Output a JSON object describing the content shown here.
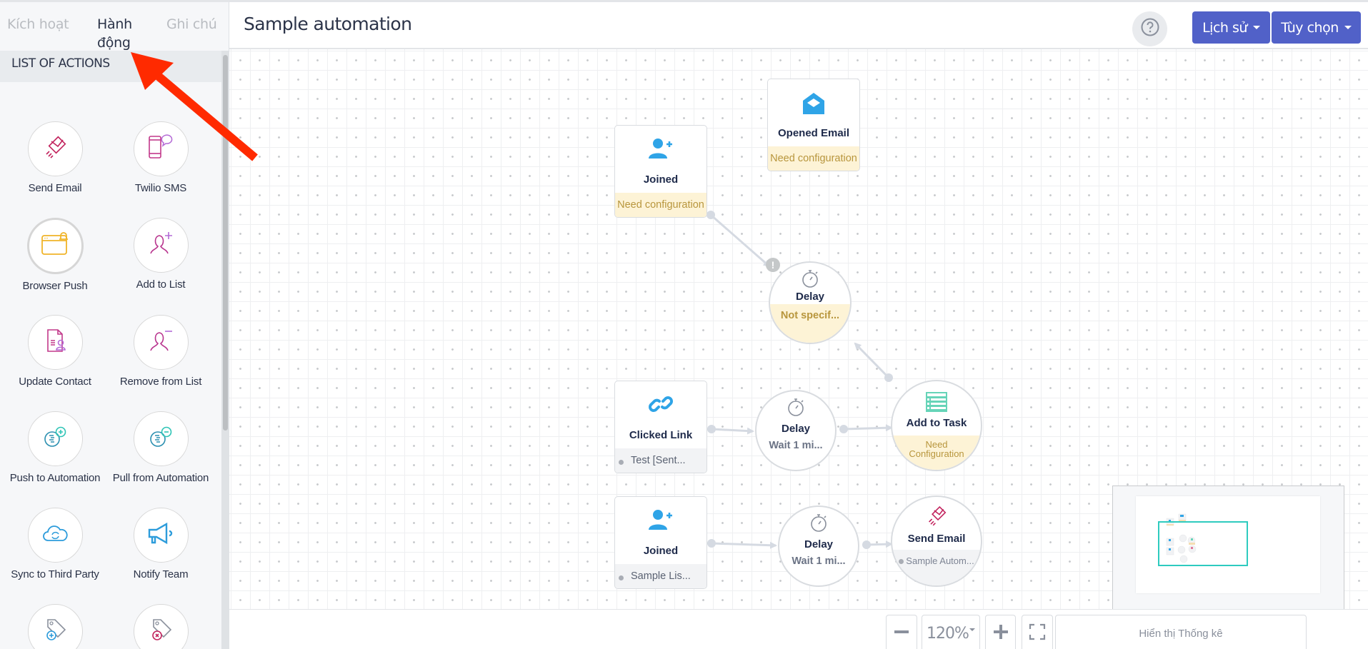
{
  "sidebar": {
    "tabs": [
      {
        "label": "Kích hoạt",
        "active": false
      },
      {
        "label": "Hành động",
        "active": true
      },
      {
        "label": "Ghi chú",
        "active": false
      }
    ],
    "list_header": "LIST OF ACTIONS",
    "actions": [
      {
        "label": "Send Email",
        "icon": "send-email-icon"
      },
      {
        "label": "Twilio SMS",
        "icon": "sms-icon"
      },
      {
        "label": "Browser Push",
        "icon": "browser-push-icon"
      },
      {
        "label": "Add to List",
        "icon": "add-user-icon"
      },
      {
        "label": "Update Contact",
        "icon": "update-contact-icon"
      },
      {
        "label": "Remove from List",
        "icon": "remove-user-icon"
      },
      {
        "label": "Push to Automation",
        "icon": "push-automation-icon"
      },
      {
        "label": "Pull from Automation",
        "icon": "pull-automation-icon"
      },
      {
        "label": "Sync to Third Party",
        "icon": "cloud-sync-icon"
      },
      {
        "label": "Notify Team",
        "icon": "megaphone-icon"
      },
      {
        "label": "",
        "icon": "add-tag-icon"
      },
      {
        "label": "",
        "icon": "remove-tag-icon"
      }
    ]
  },
  "header": {
    "title": "Sample automation",
    "help_icon": "question-icon",
    "history_label": "Lịch sử",
    "options_label": "Tùy chọn"
  },
  "canvas": {
    "nodes": {
      "joined_1": {
        "title": "Joined",
        "footer": "Need configuration",
        "icon": "user-plus-icon"
      },
      "opened_email": {
        "title": "Opened Email",
        "footer": "Need configuration",
        "icon": "envelope-open-icon"
      },
      "delay_1": {
        "title": "Delay",
        "footer": "Not specif...",
        "icon": "stopwatch-icon",
        "badge": "!"
      },
      "clicked_link": {
        "title": "Clicked Link",
        "footer": "Test [Sent...",
        "icon": "link-icon"
      },
      "delay_2": {
        "title": "Delay",
        "subtitle": "Wait  1 mi...",
        "icon": "stopwatch-icon"
      },
      "add_to_task": {
        "title": "Add to Task",
        "footer_line1": "Need",
        "footer_line2": "Configuration",
        "icon": "task-list-icon"
      },
      "joined_2": {
        "title": "Joined",
        "footer": "Sample Lis...",
        "icon": "user-plus-icon"
      },
      "delay_3": {
        "title": "Delay",
        "subtitle": "Wait  1 mi...",
        "icon": "stopwatch-icon"
      },
      "send_email": {
        "title": "Send Email",
        "footer": "Sample Autom...",
        "icon": "send-email-icon"
      }
    }
  },
  "bottombar": {
    "zoom_level": "120%",
    "stats_label": "Hiển thị Thống kê"
  },
  "colors": {
    "primary": "#5161c8",
    "warning_bg": "#fdf3d6",
    "warning_text": "#b8963d",
    "minimap_view": "#2ecbbf",
    "annotation_arrow": "#ff2a00"
  }
}
